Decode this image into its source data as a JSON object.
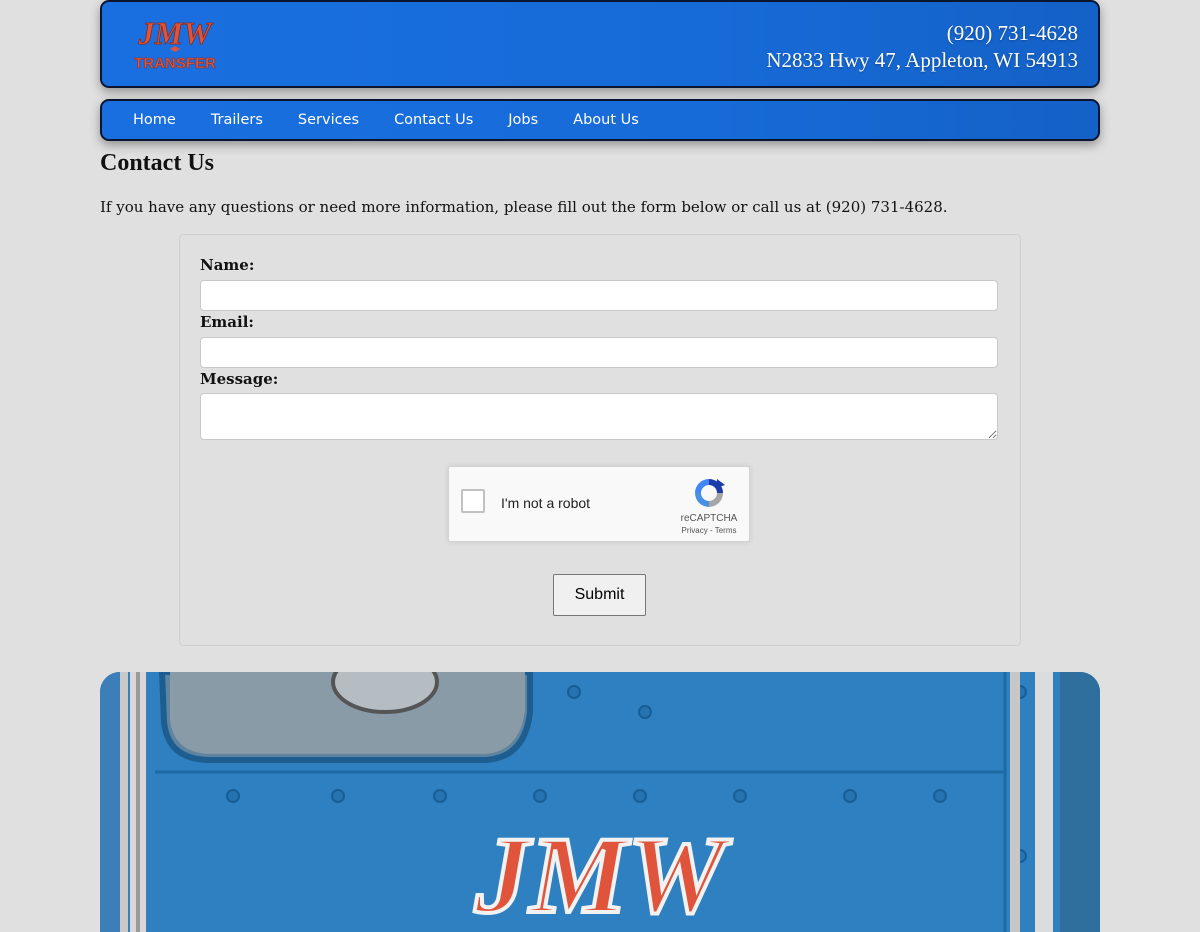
{
  "header": {
    "logo_text_top": "JMW",
    "logo_text_bottom": "TRANSFER",
    "phone": "(920) 731-4628",
    "address": "N2833 Hwy 47, Appleton, WI 54913"
  },
  "nav": {
    "items": [
      {
        "label": "Home"
      },
      {
        "label": "Trailers"
      },
      {
        "label": "Services"
      },
      {
        "label": "Contact Us"
      },
      {
        "label": "Jobs"
      },
      {
        "label": "About Us"
      }
    ]
  },
  "main": {
    "title": "Contact Us",
    "intro": "If you have any questions or need more information, please fill out the form below or call us at (920) 731-4628."
  },
  "form": {
    "name_label": "Name:",
    "name_value": "",
    "email_label": "Email:",
    "email_value": "",
    "message_label": "Message:",
    "message_value": "",
    "recaptcha_label": "I'm not a robot",
    "recaptcha_brand": "reCAPTCHA",
    "recaptcha_links": "Privacy - Terms",
    "submit_label": "Submit"
  },
  "photo": {
    "truck_lettering": "JMW"
  },
  "colors": {
    "header_blue": "#1a6fe0",
    "logo_orange": "#e0543c",
    "page_bg": "#e0e0e0",
    "truck_blue": "#2f80c0"
  }
}
